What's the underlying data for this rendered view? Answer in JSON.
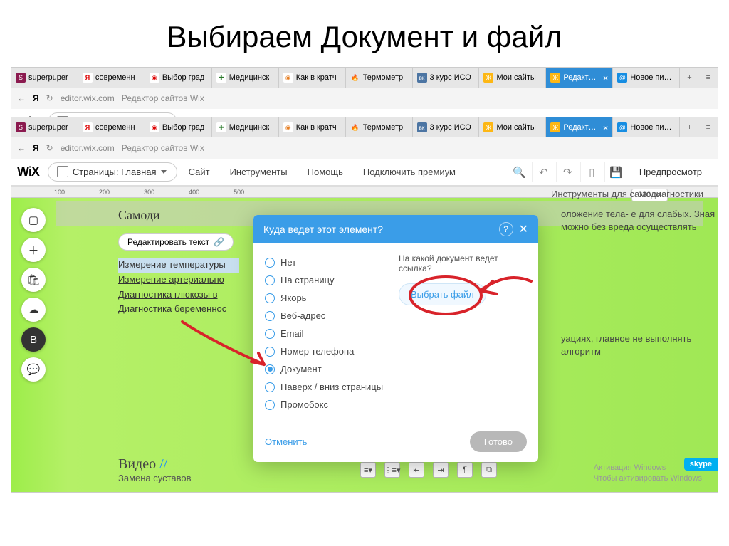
{
  "slide": {
    "title": "Выбираем Документ и файл"
  },
  "tabs": [
    {
      "label": "superpuper",
      "fav": "fav-s",
      "icon": "S"
    },
    {
      "label": "современн",
      "fav": "fav-y",
      "icon": "Я"
    },
    {
      "label": "Выбор град",
      "fav": "fav-r",
      "icon": "◉"
    },
    {
      "label": "Медицинск",
      "fav": "fav-g",
      "icon": "✚"
    },
    {
      "label": "Как в кратч",
      "fav": "fav-o",
      "icon": "◉"
    },
    {
      "label": "Термометр",
      "fav": "fav-fire",
      "icon": "🔥"
    },
    {
      "label": "3 курс ИСО",
      "fav": "fav-vk",
      "icon": "вк"
    },
    {
      "label": "Мои сайты",
      "fav": "fav-wix",
      "icon": "Ж"
    },
    {
      "label": "Редактор",
      "fav": "fav-wix",
      "icon": "Ж",
      "active": true
    },
    {
      "label": "Новое письм",
      "fav": "fav-mail",
      "icon": "@"
    }
  ],
  "addr": {
    "back": "←",
    "ya": "Я",
    "reload": "↻",
    "url": "editor.wix.com",
    "desc": "Редактор сайтов Wix"
  },
  "wix": {
    "logo": "WiX",
    "pages_label": "Страницы: Главная",
    "menu": [
      "Сайт",
      "Инструменты",
      "Помощь",
      "Подключить премиум"
    ],
    "preview": "Предпросмотр"
  },
  "canvas": {
    "ruler": [
      "100",
      "200",
      "300",
      "400",
      "500"
    ],
    "px_label": "630 px",
    "heading_right": "Инструменты для самодиагностики",
    "section_title": "Самоди",
    "edit_text": "Редактировать текст",
    "lines": {
      "l1": "Измерение температуры",
      "l2": "Измерение артериально",
      "l3": "Диагностика глюкозы в",
      "l4": "Диагностика беременнос"
    },
    "side1": "оложение тела- е для слабых. Зная можно без вреда осуществлять",
    "side2": "уациях, главное не выполнять алгоритм",
    "video_title": "Видео",
    "video_slash": "//",
    "video_sub": "Замена суставов"
  },
  "dialog": {
    "title": "Куда ведет этот элемент?",
    "help": "?",
    "close": "✕",
    "options": [
      "Нет",
      "На страницу",
      "Якорь",
      "Веб-адрес",
      "Email",
      "Номер телефона",
      "Документ",
      "Наверх / вниз страницы",
      "Промобокс"
    ],
    "selected": 6,
    "right_label": "На какой документ ведет ссылка?",
    "choose_file": "Выбрать файл",
    "cancel": "Отменить",
    "done": "Готово"
  },
  "watermark": {
    "l1": "Активация Windows",
    "l2": "Чтобы активировать Windows"
  },
  "skype": "skype"
}
